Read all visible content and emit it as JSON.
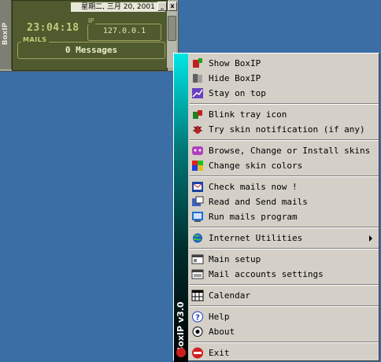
{
  "widget": {
    "side_label": "BoxIP",
    "date": "星期二, 三月 20, 2001",
    "clock": "23:04:18",
    "ip_label": "IP",
    "ip": "127.0.0.1",
    "mails_label": "MAILS",
    "mails_value": "0 Messages",
    "minimize": "_",
    "close": "x"
  },
  "menu": {
    "brand": "BoxIP v3.0",
    "items": [
      {
        "label": "Show BoxIP",
        "icon": "show-icon"
      },
      {
        "label": "Hide BoxIP",
        "icon": "hide-icon"
      },
      {
        "label": "Stay on top",
        "icon": "stay-on-top-icon"
      },
      {
        "label": "Blink tray icon",
        "icon": "blink-icon"
      },
      {
        "label": "Try skin notification (if any)",
        "icon": "bug-icon"
      },
      {
        "label": "Browse, Change or Install skins",
        "icon": "skins-icon"
      },
      {
        "label": "Change skin colors",
        "icon": "colors-icon"
      },
      {
        "label": "Check mails now !",
        "icon": "check-mail-icon"
      },
      {
        "label": "Read and Send mails",
        "icon": "read-mail-icon"
      },
      {
        "label": "Run mails program",
        "icon": "mail-program-icon"
      },
      {
        "label": "Internet Utilities",
        "icon": "globe-icon"
      },
      {
        "label": "Main setup",
        "icon": "setup-icon"
      },
      {
        "label": "Mail accounts settings",
        "icon": "accounts-icon"
      },
      {
        "label": "Calendar",
        "icon": "calendar-icon"
      },
      {
        "label": "Help",
        "icon": "help-icon"
      },
      {
        "label": "About",
        "icon": "about-icon"
      },
      {
        "label": "Exit",
        "icon": "exit-icon"
      }
    ]
  }
}
